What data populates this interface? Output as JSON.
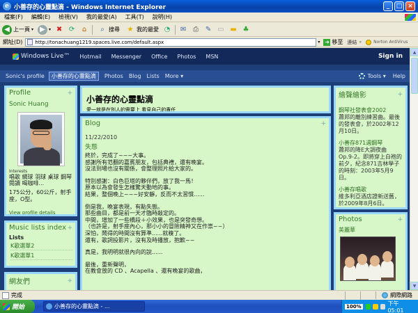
{
  "window": {
    "title": "小善存的心靈點滴 - Windows Internet Explorer",
    "controls": {
      "minimize": "_",
      "maximize": "□",
      "close": "×"
    }
  },
  "menu": [
    "檔案(F)",
    "編輯(E)",
    "檢視(V)",
    "我的最愛(A)",
    "工具(T)",
    "說明(H)"
  ],
  "toolbar": {
    "back_label": "上一頁",
    "search_label": "搜尋",
    "favorites_label": "我的最愛"
  },
  "address": {
    "label": "網址(D)",
    "url": "http://tonachuang1219.spaces.live.com/default.aspx",
    "go_label": "移至",
    "links_label": "連結",
    "norton_label": "Norton AntiVirus"
  },
  "live_header": {
    "brand": "Windows Live™",
    "nav": [
      "Hotmail",
      "Messenger",
      "Office",
      "Photos",
      "MSN"
    ],
    "sign_in": "Sign in"
  },
  "spaces_nav": {
    "items": [
      "Sonic's profile",
      "小善存的心靈點滴",
      "Photos",
      "Blog",
      "Lists",
      "More ▾"
    ],
    "active_index": 1,
    "tools": "Tools ▾",
    "help": "Help"
  },
  "profile": {
    "heading": "Profile",
    "name": "Sonic Huang",
    "interests_label": "Interests",
    "interests": "唱歌 網球 羽球 桌球 鋼琴 閱讀 喝咖啡...",
    "stats": "175公分，60公斤，射手座，O型。",
    "view_link": "View profile details"
  },
  "music_lists": {
    "heading": "Music lists index",
    "lists_label": "Lists",
    "items": [
      "K歌選單2",
      "K歌選單1"
    ]
  },
  "next_module_heading": "網友們",
  "space": {
    "title": "小善存的心靈點滴",
    "tagline": "愛一就是在別人的需要上 看見自己的責任"
  },
  "blog": {
    "heading": "Blog",
    "date": "11/22/2010",
    "post_title": "失態",
    "paragraphs": [
      "終於，完成了~~~大事。\n感謝所有范翻的嘉賓朋友，包括典禮，還有晚宴。\n沒法到場也沒有關係，會整理照片給大家的。",
      "特別感謝：白色巨塔的夥伴們，放了我一馬！\n原本以為會發生怎樣驚天動地的事。\n結果，整個晚上~~~好安靜，反而不太習慣......",
      "倒是我，晚宴表現，有點失態。\n那些曲目，都是前一天才臨時敲定的。\n中間，增加了一些橋段＋小效果，也是突發奇想。\n（也許是，射手座內心，那小小的冒險精神又在作祟~~）\n深怕，鬧得的時間沒有算準......就糗了。\n還有，歌詞投影片，沒有及時播放，抱歉~~",
      "真是，我明明就很內向的說......",
      "最後，重新聲明，\n在教會放的 CD 、Acapella 、還有晚宴的歌曲，"
    ]
  },
  "piano": {
    "heading": "繪聲繪影",
    "items": [
      {
        "title": "鋼琴社發表會2002",
        "desc": "蕭邦的離別練習曲。最後的發表會，於2002年12月10日。"
      },
      {
        "title": "小善存871週鋼琴",
        "desc": "蕭邦的降E大調夜曲 Op.9-2。即將穿上白袍的前夕，紀念871吉林學子的時刻：2003年5月9日。"
      },
      {
        "title": "小善存唱歌",
        "desc": "維多利亞酒店證新送舊，於2009年8月6日。"
      }
    ]
  },
  "photos": {
    "heading": "Photos",
    "album_title": "美麗華"
  },
  "status": {
    "text": "完成",
    "zone": "網際網路"
  },
  "taskbar": {
    "start": "開始",
    "task": "小善存的心靈點滴 - ...",
    "zoom": "100%",
    "clock": "下午 05:01"
  },
  "colors": {
    "module_bg": "#d7f7c9",
    "module_border": "#9ad7ff",
    "page_bg": "#1c3f7a",
    "heading_green": "#3a7b2c"
  }
}
